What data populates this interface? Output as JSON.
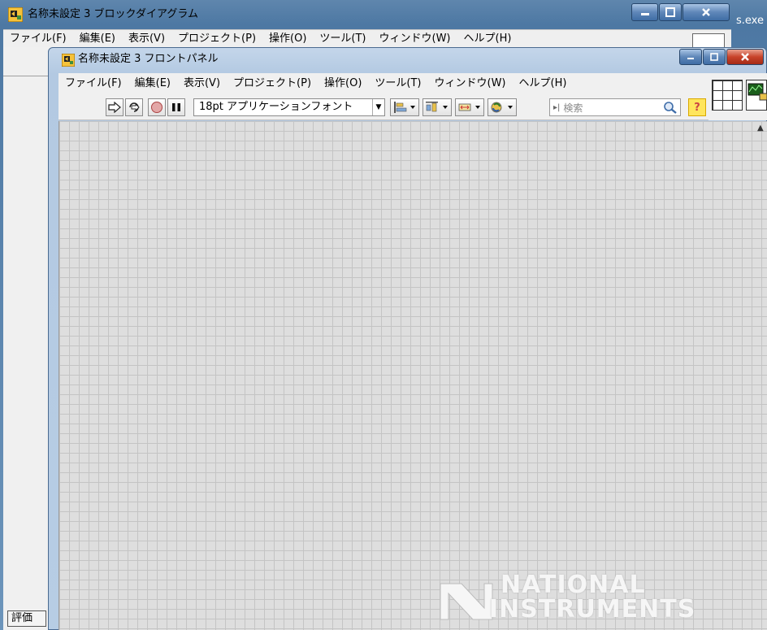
{
  "block_diagram": {
    "title": "名称未設定 3 ブロックダイアグラム",
    "exe_text": "s.exe",
    "menu": [
      "ファイル(F)",
      "編集(E)",
      "表示(V)",
      "プロジェクト(P)",
      "操作(O)",
      "ツール(T)",
      "ウィンドウ(W)",
      "ヘルプ(H)"
    ],
    "status_label": "評価"
  },
  "front_panel": {
    "title": "名称未設定 3 フロントパネル",
    "menu": [
      "ファイル(F)",
      "編集(E)",
      "表示(V)",
      "プロジェクト(P)",
      "操作(O)",
      "ツール(T)",
      "ウィンドウ(W)",
      "ヘルプ(H)"
    ],
    "toolbar": {
      "font_select": "18pt アプリケーションフォント",
      "search_placeholder": "検索",
      "help_label": "?"
    }
  },
  "watermark": {
    "line1": "NATIONAL",
    "line2": "INSTRUMENTS"
  },
  "colors": {
    "canvas": "#dedede",
    "grid": "#c4c4c4",
    "titlebar": "#b7cde4"
  }
}
